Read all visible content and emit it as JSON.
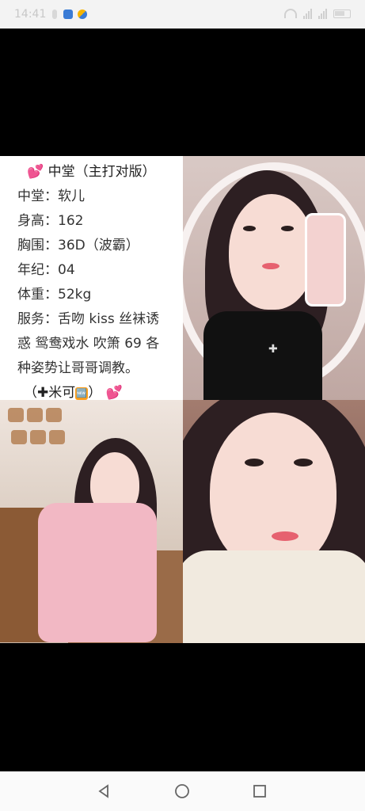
{
  "status_bar": {
    "time": "14:41"
  },
  "post": {
    "title_prefix": "💕",
    "title": "中堂（主打对版）",
    "lines": [
      {
        "label": "中堂：",
        "value": "软儿"
      },
      {
        "label": "身高：",
        "value": "162"
      },
      {
        "label": "胸围：",
        "value": "36D（波霸）"
      },
      {
        "label": "年纪：",
        "value": "04"
      },
      {
        "label": "体重：",
        "value": "52kg"
      },
      {
        "label": "服务：",
        "value": "舌吻 kiss 丝袜诱"
      },
      {
        "label": "",
        "value": "惑 鸳鸯戏水 吹箫 69 各"
      },
      {
        "label": "",
        "value": "种姿势让哥哥调教。"
      }
    ],
    "contact_prefix": "（",
    "contact_plus": "✚",
    "contact_text": "米可",
    "contact_badge": "🆕",
    "contact_suffix": "）",
    "contact_heart": "💕"
  },
  "photos": [
    {
      "name": "mirror-selfie"
    },
    {
      "name": "pink-sweater-cafe"
    },
    {
      "name": "closeup-fur-collar"
    }
  ],
  "nav": {
    "back": "back-icon",
    "home": "home-icon",
    "recent": "recent-apps-icon"
  }
}
